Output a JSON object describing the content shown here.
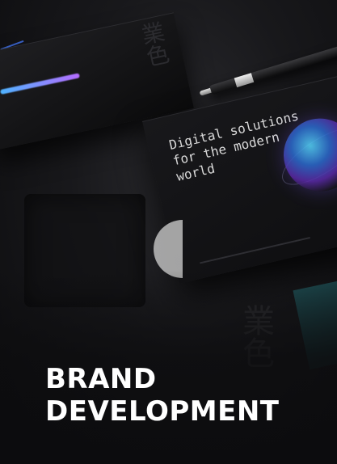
{
  "hero": {
    "title_line1": "BRAND",
    "title_line2": "DEVELOPMENT"
  },
  "mockup": {
    "board_text": "Digital solutions\nfor the modern\nworld",
    "accent_gradient": [
      "#4fb3ff",
      "#b56cff"
    ]
  }
}
